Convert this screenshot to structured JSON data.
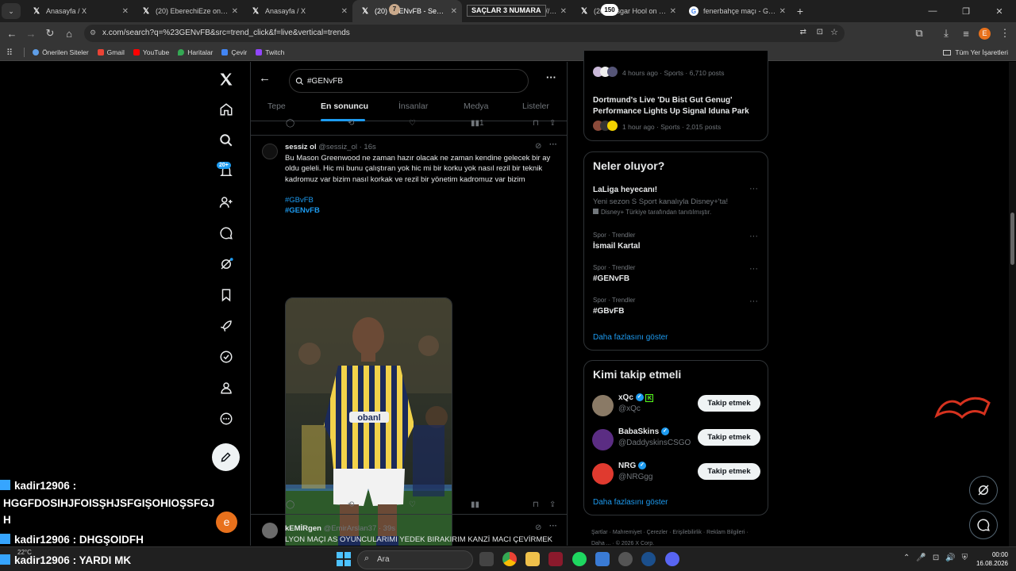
{
  "browser": {
    "tabs": [
      {
        "title": "Anasayfa / X",
        "favicon": "x-icon"
      },
      {
        "title": "(20) EberechiEze on X: \"og",
        "favicon": "x-icon"
      },
      {
        "title": "Anasayfa / X",
        "favicon": "x-icon"
      },
      {
        "title": "(20) #GENvFB - Search / X",
        "favicon": "x-icon",
        "active": true
      },
      {
        "title": "(20) ... on X: \"https://t.c",
        "favicon": "x-icon"
      },
      {
        "title": "(20) Losgar Hool on X: \"#",
        "favicon": "x-icon"
      },
      {
        "title": "fenerbahçe maçı - Google",
        "favicon": "google-icon"
      }
    ],
    "tab_overlay": "SAÇLAR 3 NUMARA",
    "tab_badge_7": "7",
    "tab_badge_150": "150",
    "url": "x.com/search?q=%23GENvFB&src=trend_click&f=live&vertical=trends",
    "profile_letter": "E",
    "bookmarks": [
      {
        "label": "Önerilen Siteler",
        "color": "#5f9ee8"
      },
      {
        "label": "Gmail",
        "color": "#ea4335"
      },
      {
        "label": "YouTube",
        "color": "#ff0000"
      },
      {
        "label": "Haritalar",
        "color": "#34a853"
      },
      {
        "label": "Çevir",
        "color": "#4285f4"
      },
      {
        "label": "Twitch",
        "color": "#9146ff"
      }
    ],
    "all_bookmarks": "Tüm Yer İşaretleri"
  },
  "nav": {
    "notification_badge": "20+",
    "user_initial": "e"
  },
  "search": {
    "query": "#GENvFB",
    "tabs": [
      "Tepe",
      "En sonuncu",
      "İnsanlar",
      "Medya",
      "Listeler"
    ],
    "active_tab": "En sonuncu"
  },
  "feed": {
    "prev_views": "1",
    "tweet1": {
      "name": "sessiz ol",
      "handle": "@sessiz_ol · 16s",
      "text": "Bu Mason Greenwood ne zaman hazır olacak ne zaman kendine gelecek bir ay oldu geleli. Hic mi bunu çalıştıran yok hic mi bir korku yok nasıl rezil bir teknik kadromuz var bizim nasıl korkak ve rezil bir yönetim kadromuz var bizim",
      "tags": [
        "#GBvFB",
        "#GENvFB"
      ],
      "shirt_text": "obanl"
    },
    "tweet2": {
      "name": "kEMİRgen",
      "handle": "@EmirArslan37 · 39s",
      "text": "LYON MAÇI AS OYUNCULARIMI YEDEK BIRAKIRIM KANZİ MACI ÇEVİRMEK"
    }
  },
  "sidebar": {
    "top_trends": [
      {
        "meta": "4 hours ago · Sports · 6,710 posts"
      },
      {
        "title": "Dortmund's Live 'Du Bist Gut Genug' Performance Lights Up Signal Iduna Park",
        "meta": "1 hour ago · Sports · 2,015 posts"
      }
    ],
    "whats_happening": {
      "title": "Neler oluyor?",
      "promo": {
        "title": "LaLiga heyecanı!",
        "text": "Yeni sezon S Sport kanalıyla Disney+'ta!",
        "sponsor": "Disney+ Türkiye tarafından tanıtılmıştır."
      },
      "trends": [
        {
          "cat": "Spor · Trendler",
          "name": "İsmail Kartal"
        },
        {
          "cat": "Spor · Trendler",
          "name": "#GENvFB"
        },
        {
          "cat": "Spor · Trendler",
          "name": "#GBvFB"
        }
      ],
      "more": "Daha fazlasını göster"
    },
    "who_to_follow": {
      "title": "Kimi takip etmeli",
      "accounts": [
        {
          "name": "xQc",
          "handle": "@xQc",
          "color": "#8a7a66"
        },
        {
          "name": "BabaSkins",
          "handle": "@DaddyskinsCSGO",
          "color": "#5b2d83"
        },
        {
          "name": "NRG",
          "handle": "@NRGgg",
          "color": "#e03a2f"
        }
      ],
      "button": "Takip etmek",
      "more": "Daha fazlasını göster"
    },
    "footer": [
      "Şartlar",
      "Mahremiyet",
      "Çerezler",
      "Erişilebilirlik",
      "Reklam Bilgileri",
      "Daha ...",
      "© 2026 X Corp."
    ]
  },
  "chat": {
    "lines": [
      {
        "user": "kadir12906",
        "msg": ":"
      },
      {
        "user": "",
        "msg": "HGGFDOSIHJFOISŞHJSFGIŞOHIOŞSFGJ"
      },
      {
        "user": "",
        "msg": "H"
      },
      {
        "user": "kadir12906",
        "msg": ": DHGŞOIDFH"
      },
      {
        "user": "kadir12906",
        "msg": ": YARDI MK"
      }
    ]
  },
  "taskbar": {
    "weather": "22°C",
    "search": "Ara",
    "time": "00:00",
    "date": "16.08.2026"
  },
  "colors": {
    "accent": "#1d9bf0",
    "bg": "#000000",
    "border": "#2f3336",
    "muted": "#71767b"
  }
}
